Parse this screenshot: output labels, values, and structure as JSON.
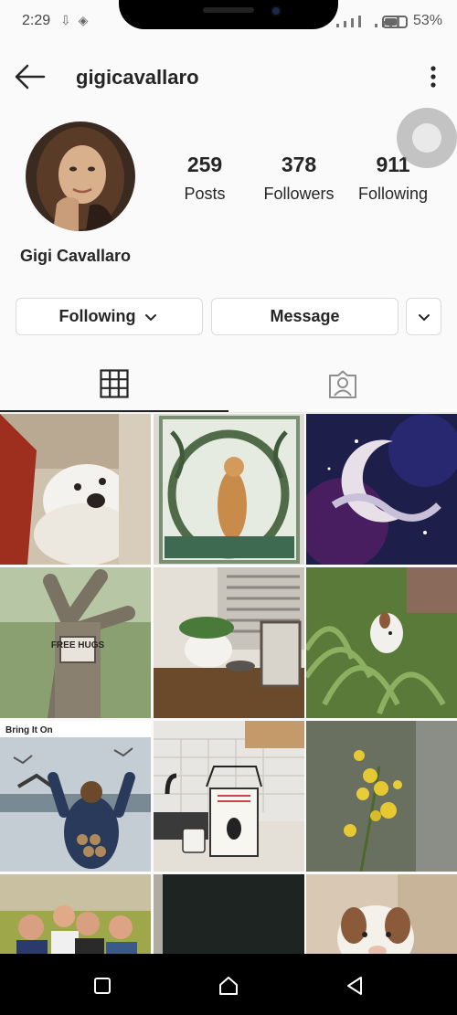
{
  "status_bar": {
    "time": "2:29",
    "left_icons": "⇩ ◈",
    "battery_percent": "53%"
  },
  "header": {
    "username": "gigicavallaro"
  },
  "profile": {
    "posts_count": "259",
    "posts_label": "Posts",
    "followers_count": "378",
    "followers_label": "Followers",
    "following_count": "911",
    "following_label": "Following",
    "full_name": "Gigi Cavallaro"
  },
  "actions": {
    "following_label": "Following",
    "message_label": "Message"
  },
  "posts": [
    {
      "text": ""
    },
    {
      "text": ""
    },
    {
      "text": ""
    },
    {
      "text": "FREE HUGS"
    },
    {
      "text": ""
    },
    {
      "text": ""
    },
    {
      "text": "Bring It On"
    },
    {
      "text": ""
    },
    {
      "text": ""
    },
    {
      "text": ""
    },
    {
      "text": ""
    },
    {
      "text": ""
    }
  ],
  "colors": {
    "background": "#fafafa",
    "text": "#262626",
    "border": "#dbdbdb"
  }
}
